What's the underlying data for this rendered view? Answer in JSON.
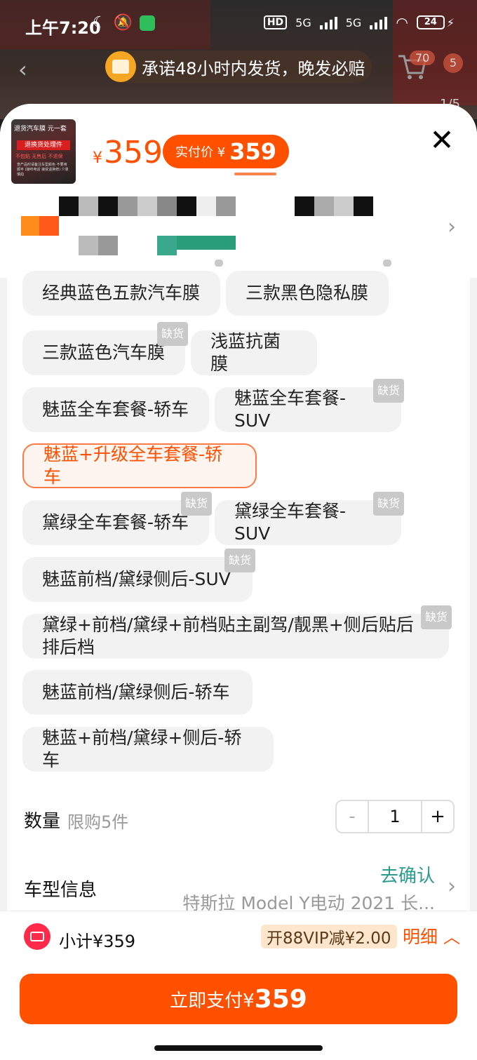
{
  "status_bar": {
    "time": "上午7:20",
    "net1": "5G",
    "net2": "5G",
    "battery": "24"
  },
  "banner": {
    "text": "承诺48小时内发货，晚发必赔",
    "cart_count": "70",
    "cart_count2": "5",
    "pager": "1/5"
  },
  "product": {
    "thumb_top": "退货汽车膜 元一套",
    "thumb_red": "退换货处理件",
    "thumb_sub": "不包贴 无售后 不退保",
    "thumb_note": "查产品时请备注车型颜色 不要用 顺丰 (接听电话 接受退换修) 介意慎拍",
    "price_yen": "¥",
    "price": "359",
    "real_label": "实付价 ¥",
    "real_price": "359"
  },
  "options": [
    {
      "label": "经典蓝色五款汽车膜",
      "stock": ""
    },
    {
      "label": "三款黑色隐私膜",
      "stock": ""
    },
    {
      "label": "三款蓝色汽车膜",
      "stock": "缺货"
    },
    {
      "label": "浅蓝抗菌膜",
      "stock": ""
    },
    {
      "label": "魅蓝全车套餐-轿车",
      "stock": ""
    },
    {
      "label": "魅蓝全车套餐-SUV",
      "stock": "缺货"
    },
    {
      "label": "魅蓝+升级全车套餐-轿车",
      "stock": ""
    },
    {
      "label": "黛绿全车套餐-轿车",
      "stock": "缺货"
    },
    {
      "label": "黛绿全车套餐-SUV",
      "stock": "缺货"
    },
    {
      "label": "魅蓝前档/黛绿侧后-SUV",
      "stock": "缺货"
    },
    {
      "label": "黛绿+前档/黛绿+前档贴主副驾/靓黑+侧后贴后排后档",
      "stock": "缺货"
    },
    {
      "label": "魅蓝前档/黛绿侧后-轿车",
      "stock": ""
    },
    {
      "label": "魅蓝+前档/黛绿+侧后-轿车",
      "stock": ""
    }
  ],
  "quantity": {
    "label": "数量",
    "limit": "限购5件",
    "minus": "-",
    "value": "1",
    "plus": "+"
  },
  "car": {
    "label": "车型信息",
    "confirm": "去确认",
    "model": "特斯拉 Model Y电动 2021 长..."
  },
  "footer": {
    "subtotal": "小计¥359",
    "vip": "开88VIP减¥2.00",
    "detail": "明细",
    "pay_label": "立即支付¥",
    "pay_price": "359"
  }
}
